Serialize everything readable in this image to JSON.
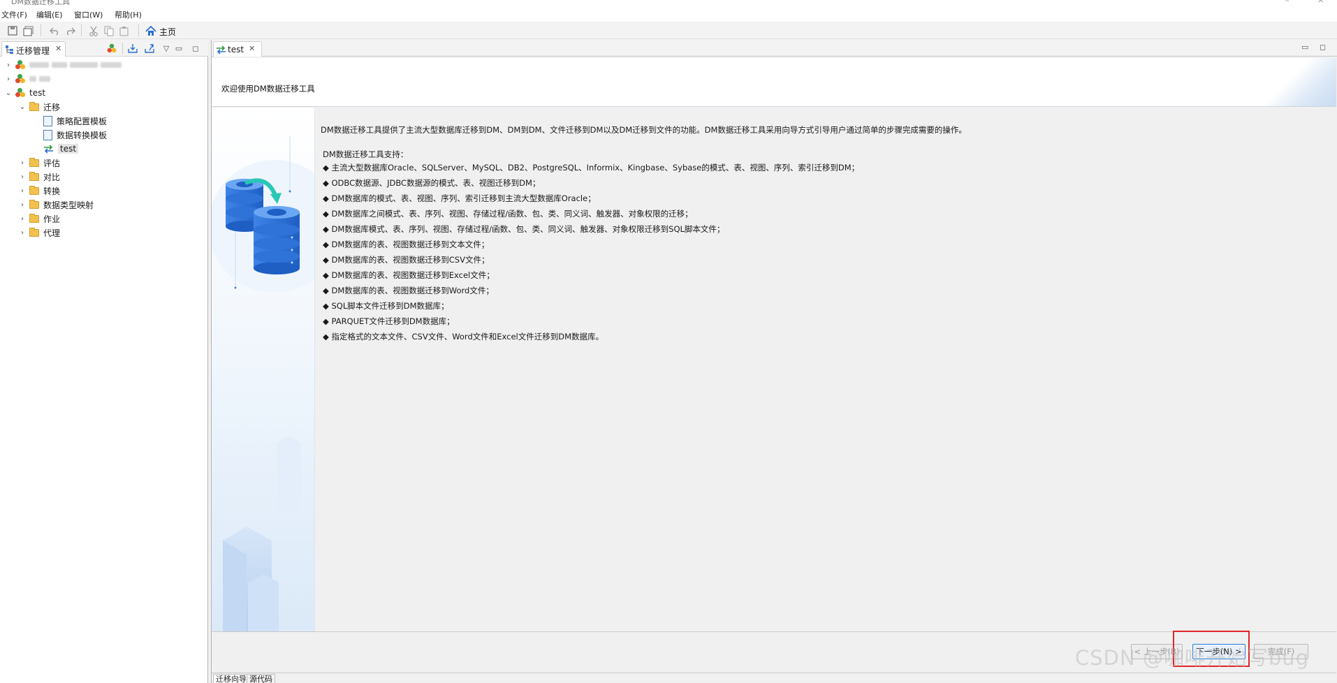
{
  "window": {
    "title": "DM数据迁移工具",
    "minimize": "–",
    "close": "✕"
  },
  "menu": [
    "文件(F)",
    "编辑(E)",
    "窗口(W)",
    "帮助(H)"
  ],
  "toolbar": {
    "home_label": "主页",
    "icons": [
      "save-icon",
      "save-all-icon",
      "undo-icon",
      "redo-icon",
      "cut-icon",
      "copy-icon",
      "paste-icon",
      "home-icon"
    ]
  },
  "left_panel": {
    "tab_label": "迁移管理",
    "tree": {
      "root_test": "test",
      "folder_migrate": "迁移",
      "item_strategy": "策略配置模板",
      "item_convert_tpl": "数据转换模板",
      "item_test": "test",
      "folder_assess": "评估",
      "folder_compare": "对比",
      "folder_convert": "转换",
      "folder_typemap": "数据类型映射",
      "folder_job": "作业",
      "folder_agent": "代理"
    }
  },
  "editor": {
    "tab_label": "test",
    "wizard_title": "欢迎使用DM数据迁移工具",
    "intro": "DM数据迁移工具提供了主流大型数据库迁移到DM、DM到DM、文件迁移到DM以及DM迁移到文件的功能。DM数据迁移工具采用向导方式引导用户通过简单的步骤完成需要的操作。",
    "support_heading": "DM数据迁移工具支持：",
    "support_items": [
      "◆ 主流大型数据库Oracle、SQLServer、MySQL、DB2、PostgreSQL、Informix、Kingbase、Sybase的模式、表、视图、序列、索引迁移到DM；",
      "◆ ODBC数据源、JDBC数据源的模式、表、视图迁移到DM；",
      "◆ DM数据库的模式、表、视图、序列、索引迁移到主流大型数据库Oracle；",
      "◆ DM数据库之间模式、表、序列、视图、存储过程/函数、包、类、同义词、触发器、对象权限的迁移；",
      "◆ DM数据库模式、表、序列、视图、存储过程/函数、包、类、同义词、触发器、对象权限迁移到SQL脚本文件；",
      "◆ DM数据库的表、视图数据迁移到文本文件；",
      "◆ DM数据库的表、视图数据迁移到CSV文件；",
      "◆ DM数据库的表、视图数据迁移到Excel文件；",
      "◆ DM数据库的表、视图数据迁移到Word文件；",
      "◆ SQL脚本文件迁移到DM数据库；",
      "◆ PARQUET文件迁移到DM数据库；",
      "◆ 指定格式的文本文件、CSV文件、Word文件和Excel文件迁移到DM数据库。"
    ],
    "buttons": {
      "back": "< 上一步(B)",
      "next": "下一步(N) >",
      "finish": "完成(F)"
    },
    "bottom_tabs": [
      "迁移向导",
      "源代码"
    ]
  },
  "watermark": "CSDN @咖啡开始写bug"
}
